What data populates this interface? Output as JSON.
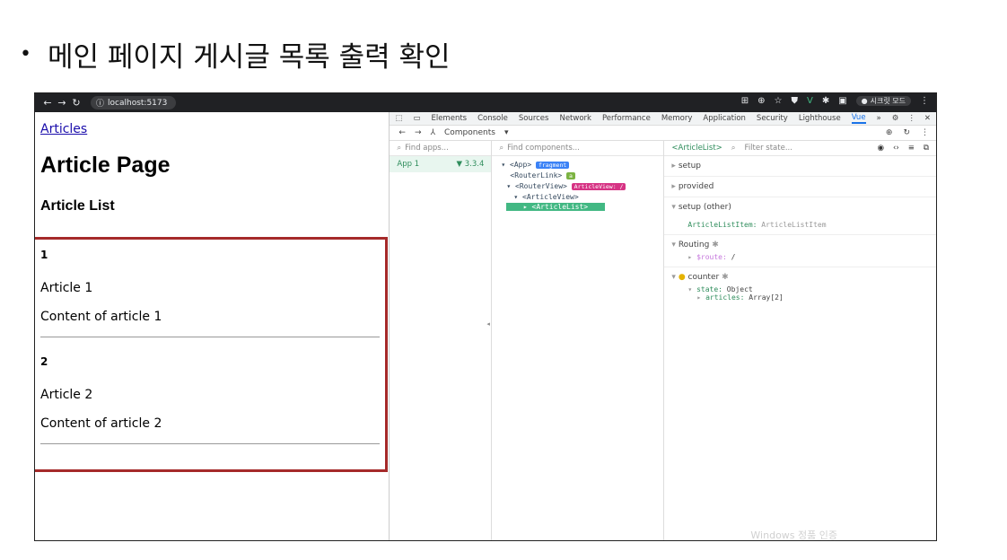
{
  "slide_title": "메인 페이지 게시글 목록 출력 확인",
  "browser": {
    "url": "localhost:5173",
    "profile_label": "시크릿 모드"
  },
  "page": {
    "link": "Articles",
    "heading": "Article Page",
    "subheading": "Article List",
    "articles": [
      {
        "id": "1",
        "title": "Article 1",
        "content": "Content of article 1"
      },
      {
        "id": "2",
        "title": "Article 2",
        "content": "Content of article 2"
      }
    ]
  },
  "devtools": {
    "tabs": [
      "Elements",
      "Console",
      "Sources",
      "Network",
      "Performance",
      "Memory",
      "Application",
      "Security",
      "Lighthouse",
      "Vue"
    ],
    "active_tab": "Vue",
    "components_label": "Components",
    "find_apps_placeholder": "Find apps...",
    "find_components_placeholder": "Find components...",
    "app_label": "App 1",
    "app_version": "3.3.4",
    "tree": {
      "app": "<App>",
      "fragment_tag": "fragment",
      "router_link": "<RouterLink>",
      "router_link_tag": "a",
      "router_view": "<RouterView>",
      "router_view_tag": "ArticleView: /",
      "article_view": "<ArticleView>",
      "article_list": "<ArticleList>"
    },
    "state": {
      "component": "<ArticleList>",
      "filter_placeholder": "Filter state...",
      "setup": "setup",
      "provided": "provided",
      "setup_other": "setup (other)",
      "setup_other_key": "ArticleListItem:",
      "setup_other_val": "ArticleListItem",
      "routing": "Routing",
      "route_key": "$route:",
      "route_val": "/",
      "counter": "counter",
      "state_key": "state:",
      "state_val": "Object",
      "articles_key": "articles:",
      "articles_val": "Array[2]"
    },
    "watermark": "Windows 정품 인증"
  },
  "colors": {
    "highlight_border": "#a52a2a",
    "vue_green": "#42b883"
  }
}
